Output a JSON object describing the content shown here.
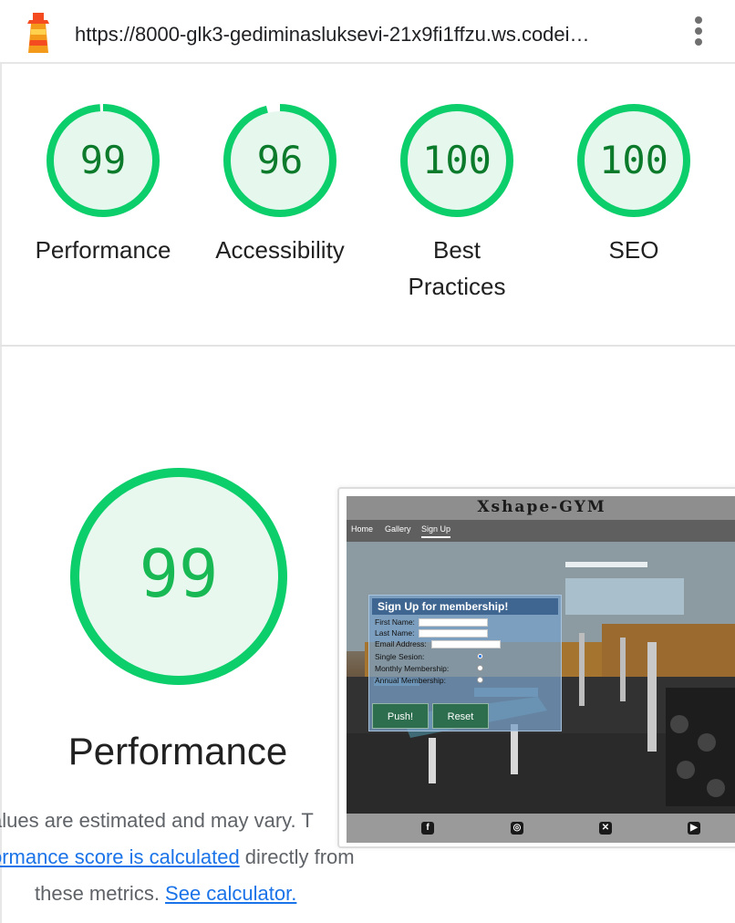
{
  "browser": {
    "url": "https://8000-glk3-gediminasluksevi-21x9fi1ffzu.ws.codei…",
    "menu_icon": "kebab-menu-icon",
    "logo_icon": "lighthouse-icon"
  },
  "gauges": [
    {
      "label": "Performance",
      "score": "99",
      "value": 99
    },
    {
      "label": "Accessibility",
      "score": "96",
      "value": 96
    },
    {
      "label": "Best Practices",
      "score": "100",
      "value": 100
    },
    {
      "label": "SEO",
      "score": "100",
      "value": 100
    }
  ],
  "performance": {
    "score": "99",
    "value": 99,
    "title": "Performance",
    "desc_line1": "alues are estimated and may vary. T",
    "desc_link1": "ormance score is calculated",
    "desc_line2_rest": " directly from",
    "desc_line3": "these metrics. ",
    "desc_link2": "See calculator."
  },
  "screenshot": {
    "site_title": "Xshape-GYM",
    "nav": [
      "Home",
      "Gallery",
      "Sign Up"
    ],
    "form_title": "Sign Up for membership!",
    "fields": [
      "First Name:",
      "Last Name:",
      "Email Address:"
    ],
    "options": [
      "Single Sesion:",
      "Monthly Membership:",
      "Annual Membership:"
    ],
    "buttons": [
      "Push!",
      "Reset"
    ],
    "footer_icons": [
      "facebook-icon",
      "instagram-icon",
      "x-icon",
      "youtube-icon"
    ]
  },
  "colors": {
    "gauge_pass": "#0cce6b",
    "gauge_fill": "#e6f8ee",
    "score_text": "#0b7a2a",
    "link": "#1a73e8"
  }
}
